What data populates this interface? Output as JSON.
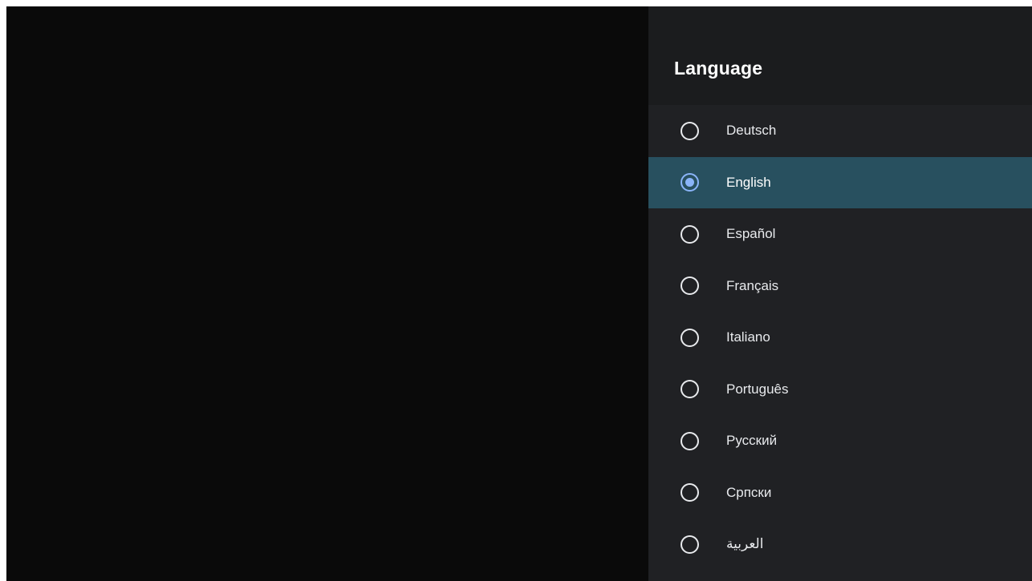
{
  "panel": {
    "title": "Language"
  },
  "languages": [
    {
      "label": "Deutsch",
      "selected": false
    },
    {
      "label": "English",
      "selected": true
    },
    {
      "label": "Español",
      "selected": false
    },
    {
      "label": "Français",
      "selected": false
    },
    {
      "label": "Italiano",
      "selected": false
    },
    {
      "label": "Português",
      "selected": false
    },
    {
      "label": "Русский",
      "selected": false
    },
    {
      "label": "Српски",
      "selected": false
    },
    {
      "label": "العربية",
      "selected": false
    }
  ],
  "colors": {
    "panel_bg": "#202124",
    "header_bg": "#1b1c1e",
    "selected_row": "#28505f",
    "accent": "#8ab4f8",
    "backdrop": "#0a0a0a"
  }
}
